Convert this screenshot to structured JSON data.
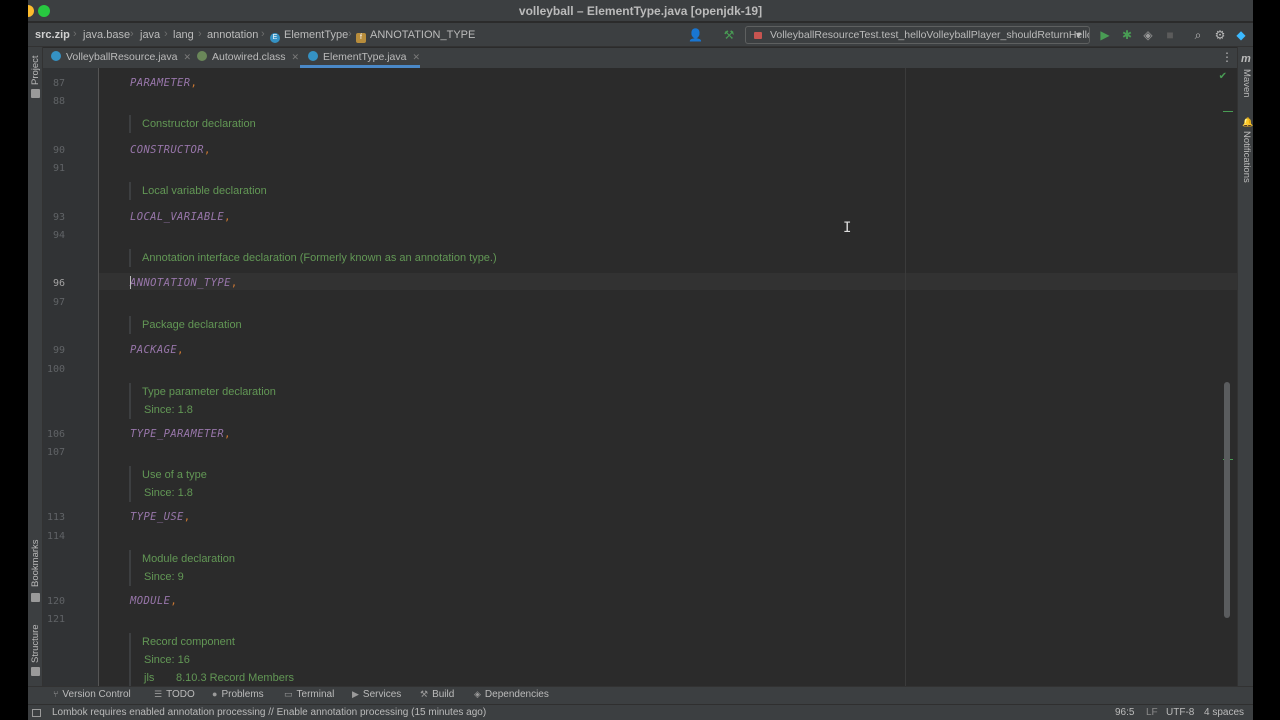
{
  "window": {
    "title": "volleyball – ElementType.java [openjdk-19]"
  },
  "breadcrumb": [
    {
      "label": "src.zip",
      "icon": "archive-icon"
    },
    {
      "label": "java.base",
      "icon": "module-icon"
    },
    {
      "label": "java",
      "icon": "package-icon"
    },
    {
      "label": "lang",
      "icon": "package-icon"
    },
    {
      "label": "annotation",
      "icon": "package-icon"
    },
    {
      "label": "ElementType",
      "icon": "enum-icon"
    },
    {
      "label": "ANNOTATION_TYPE",
      "icon": "enum-constant-icon"
    }
  ],
  "toolbar": {
    "run_config": "VolleyballResourceTest.test_helloVolleyballPlayer_shouldReturnHello",
    "icons": [
      "user-icon",
      "hammer-icon",
      "run-icon",
      "debug-icon",
      "coverage-icon",
      "stop-icon",
      "search-icon",
      "gear-icon",
      "jetbrains-icon"
    ]
  },
  "tabs": [
    {
      "label": "VolleyballResource.java",
      "active": false
    },
    {
      "label": "Autowired.class",
      "active": false
    },
    {
      "label": "ElementType.java",
      "active": true
    }
  ],
  "side_tools": {
    "left": [
      "Project",
      "Bookmarks",
      "Structure"
    ],
    "right": [
      "Maven",
      "Notifications"
    ]
  },
  "editor": {
    "lines": {
      "l87": "87",
      "l88": "88",
      "l90": "90",
      "l91": "91",
      "l93": "93",
      "l94": "94",
      "l96": "96",
      "l97": "97",
      "l99": "99",
      "l100": "100",
      "l106": "106",
      "l107": "107",
      "l113": "113",
      "l114": "114",
      "l120": "120",
      "l121": "121"
    },
    "code": {
      "parameter": "PARAMETER",
      "constructor": "CONSTRUCTOR",
      "local_variable": "LOCAL_VARIABLE",
      "annotation_type": "ANNOTATION_TYPE",
      "package": "PACKAGE",
      "type_parameter": "TYPE_PARAMETER",
      "type_use": "TYPE_USE",
      "module": "MODULE",
      "comma": ","
    },
    "docs": {
      "constructor": "Constructor declaration",
      "local_variable": "Local variable declaration",
      "annotation_type": "Annotation interface declaration (Formerly known as an annotation type.)",
      "package": "Package declaration",
      "type_parameter": "Type parameter declaration",
      "type_parameter_since": "Since: 1.8",
      "type_use": "Use of a type",
      "type_use_since": "Since: 1.8",
      "module": "Module declaration",
      "module_since": "Since: 9",
      "record_component": "Record component",
      "record_since": "Since: 16",
      "jls_key": "jls",
      "jls_value": "8.10.3 Record Members"
    }
  },
  "tool_windows": [
    {
      "label": "Version Control",
      "icon": "branch-icon"
    },
    {
      "label": "TODO",
      "icon": "list-icon"
    },
    {
      "label": "Problems",
      "icon": "problems-icon"
    },
    {
      "label": "Terminal",
      "icon": "terminal-icon"
    },
    {
      "label": "Services",
      "icon": "services-icon"
    },
    {
      "label": "Build",
      "icon": "hammer-icon"
    },
    {
      "label": "Dependencies",
      "icon": "dependencies-icon"
    }
  ],
  "status": {
    "message": "Lombok requires enabled annotation processing // Enable annotation processing (15 minutes ago)",
    "position": "96:5",
    "line_sep": "LF",
    "encoding": "UTF-8",
    "indent": "4 spaces"
  },
  "colors": {
    "accent": "#4a88c7",
    "doc_comment": "#629755",
    "enum_constant": "#9876aa",
    "keyword": "#cc7832"
  }
}
